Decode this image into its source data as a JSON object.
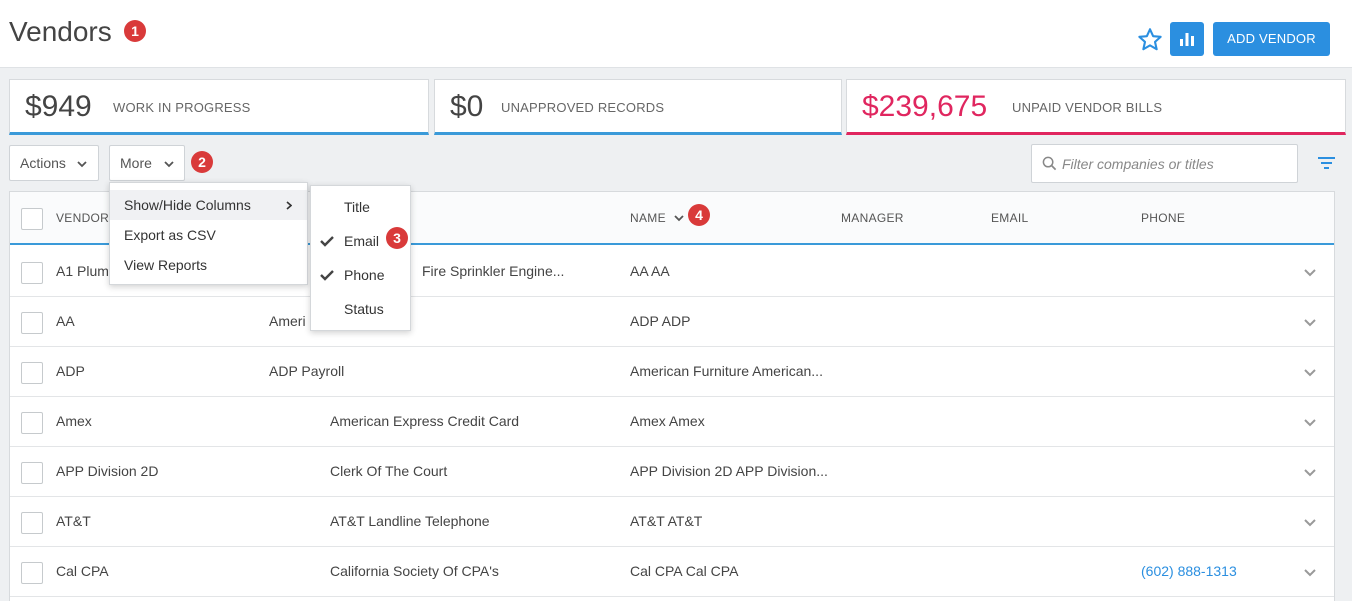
{
  "header": {
    "title": "Vendors",
    "add_button": "ADD VENDOR",
    "star_icon": "star-outline-icon",
    "chart_icon": "bar-chart-icon"
  },
  "badges": {
    "b1": "1",
    "b2": "2",
    "b3": "3",
    "b4": "4"
  },
  "summary": [
    {
      "amount": "$949",
      "label": "WORK IN PROGRESS"
    },
    {
      "amount": "$0",
      "label": "UNAPPROVED RECORDS"
    },
    {
      "amount": "$239,675",
      "label": "UNPAID VENDOR BILLS"
    }
  ],
  "toolbar": {
    "actions_label": "Actions",
    "more_label": "More",
    "filter_placeholder": "Filter companies or titles"
  },
  "more_menu": {
    "items": [
      "Show/Hide Columns",
      "Export as CSV",
      "View Reports"
    ]
  },
  "columns_submenu": {
    "items": [
      {
        "label": "Title",
        "checked": false
      },
      {
        "label": "Email",
        "checked": true
      },
      {
        "label": "Phone",
        "checked": true
      },
      {
        "label": "Status",
        "checked": false
      }
    ]
  },
  "table": {
    "headers": {
      "vendor": "VENDOR",
      "name": "NAME",
      "manager": "MANAGER",
      "email": "EMAIL",
      "phone": "PHONE"
    },
    "rows": [
      {
        "vendor": "A1 Plum",
        "company": "Fire Sprinkler Engine...",
        "name": "AA AA",
        "phone": ""
      },
      {
        "vendor": "AA",
        "company": "Ameri",
        "name": "ADP ADP",
        "phone": ""
      },
      {
        "vendor": "ADP",
        "company": "ADP Payroll",
        "name": "American Furniture American...",
        "phone": ""
      },
      {
        "vendor": "Amex",
        "company": "American Express Credit Card",
        "name": "Amex Amex",
        "phone": ""
      },
      {
        "vendor": "APP Division 2D",
        "company": "Clerk Of The Court",
        "name": "APP Division 2D APP Division...",
        "phone": ""
      },
      {
        "vendor": "AT&T",
        "company": "AT&T Landline Telephone",
        "name": "AT&T AT&T",
        "phone": ""
      },
      {
        "vendor": "Cal CPA",
        "company": "California Society Of CPA's",
        "name": "Cal CPA Cal CPA",
        "phone": "(602) 888-1313"
      }
    ]
  },
  "colors": {
    "accent": "#2b8fe0",
    "pink": "#e0265f",
    "badge": "#d93a3a"
  }
}
